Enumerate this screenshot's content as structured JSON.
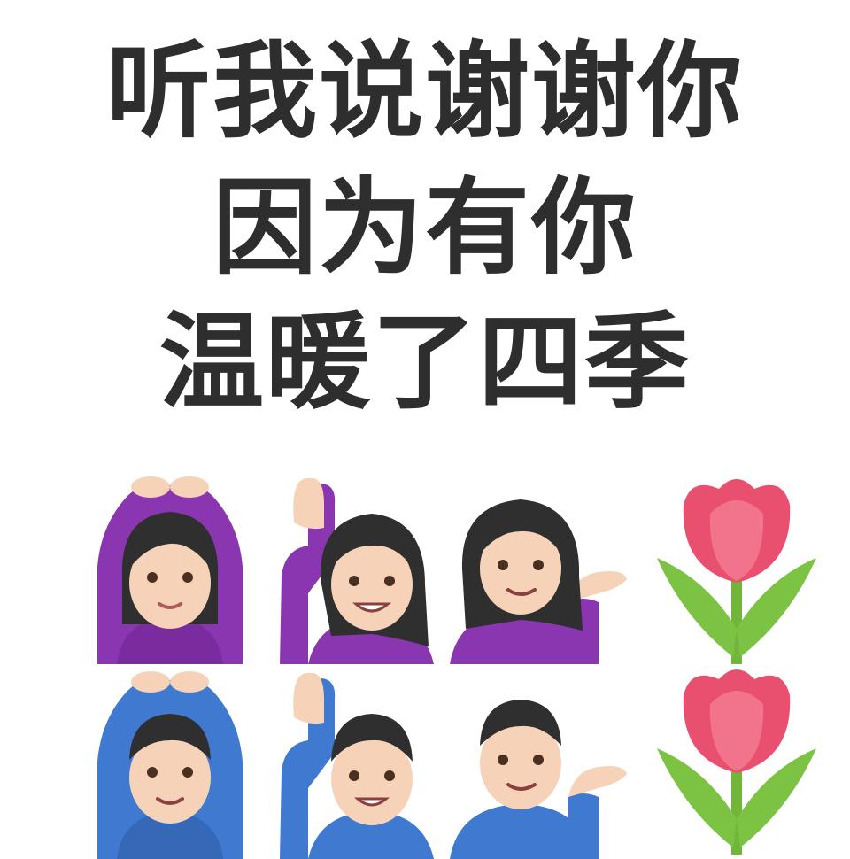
{
  "caption": {
    "line1": "听我说谢谢你",
    "line2": "因为有你",
    "line3": "温暖了四季"
  },
  "stickers": {
    "row1": [
      "woman-gesturing-ok-icon",
      "woman-raising-hand-icon",
      "woman-tipping-hand-icon",
      "tulip-icon"
    ],
    "row2": [
      "man-gesturing-ok-icon",
      "man-raising-hand-icon",
      "man-tipping-hand-icon",
      "tulip-icon"
    ]
  },
  "colors": {
    "text": "#2e2e2e",
    "woman_shirt": "#8a36b0",
    "man_shirt": "#3f7ad0",
    "skin": "#f6d3b8",
    "hair": "#2f2f2f",
    "tulip_petal": "#e9506f",
    "tulip_leaf": "#7cc243"
  }
}
